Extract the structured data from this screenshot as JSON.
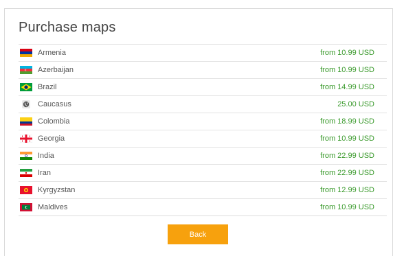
{
  "dialog": {
    "title": "Purchase maps"
  },
  "maps": [
    {
      "name": "Armenia",
      "price": "from 10.99 USD",
      "icon": "armenia-flag-icon"
    },
    {
      "name": "Azerbaijan",
      "price": "from 10.99 USD",
      "icon": "azerbaijan-flag-icon"
    },
    {
      "name": "Brazil",
      "price": "from 14.99 USD",
      "icon": "brazil-flag-icon"
    },
    {
      "name": "Caucasus",
      "price": "25.00 USD",
      "icon": "globe-icon"
    },
    {
      "name": "Colombia",
      "price": "from 18.99 USD",
      "icon": "colombia-flag-icon"
    },
    {
      "name": "Georgia",
      "price": "from 10.99 USD",
      "icon": "georgia-flag-icon"
    },
    {
      "name": "India",
      "price": "from 22.99 USD",
      "icon": "india-flag-icon"
    },
    {
      "name": "Iran",
      "price": "from 22.99 USD",
      "icon": "iran-flag-icon"
    },
    {
      "name": "Kyrgyzstan",
      "price": "from 12.99 USD",
      "icon": "kyrgyzstan-flag-icon"
    },
    {
      "name": "Maldives",
      "price": "from 10.99 USD",
      "icon": "maldives-flag-icon"
    }
  ],
  "actions": {
    "back_label": "Back"
  },
  "colors": {
    "price_green": "#3a9a2c",
    "button_orange": "#f7a10d",
    "title_gray": "#444444"
  }
}
